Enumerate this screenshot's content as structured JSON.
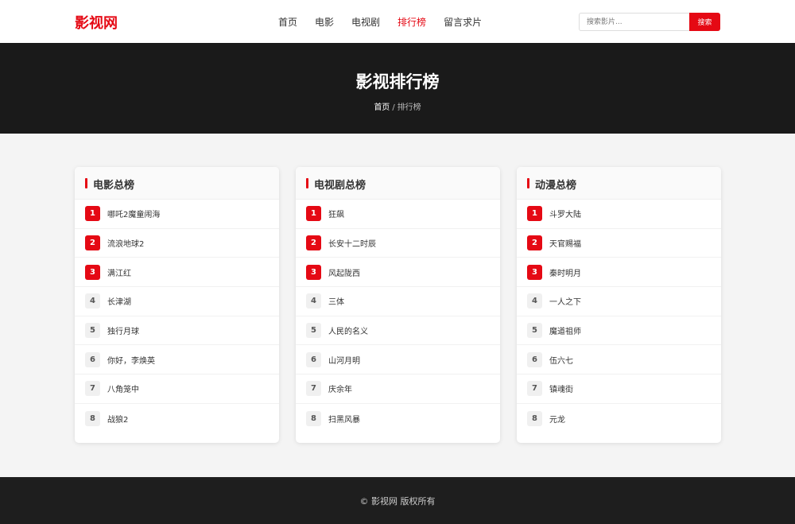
{
  "header": {
    "logo": "影视网",
    "nav": [
      {
        "label": "首页",
        "active": false
      },
      {
        "label": "电影",
        "active": false
      },
      {
        "label": "电视剧",
        "active": false
      },
      {
        "label": "排行榜",
        "active": true
      },
      {
        "label": "留言求片",
        "active": false
      }
    ],
    "search": {
      "placeholder": "搜索影片...",
      "value": "",
      "button_label": "搜索"
    }
  },
  "hero": {
    "title": "影视排行榜",
    "breadcrumb": {
      "home": "首页",
      "separator": "/",
      "current": "排行榜"
    }
  },
  "boards": [
    {
      "title": "电影总榜",
      "items": [
        {
          "rank": "1",
          "name": "哪吒2魔童闹海"
        },
        {
          "rank": "2",
          "name": "流浪地球2"
        },
        {
          "rank": "3",
          "name": "满江红"
        },
        {
          "rank": "4",
          "name": "长津湖"
        },
        {
          "rank": "5",
          "name": "独行月球"
        },
        {
          "rank": "6",
          "name": "你好，李焕英"
        },
        {
          "rank": "7",
          "name": "八角笼中"
        },
        {
          "rank": "8",
          "name": "战狼2"
        }
      ]
    },
    {
      "title": "电视剧总榜",
      "items": [
        {
          "rank": "1",
          "name": "狂飙"
        },
        {
          "rank": "2",
          "name": "长安十二时辰"
        },
        {
          "rank": "3",
          "name": "风起陇西"
        },
        {
          "rank": "4",
          "name": "三体"
        },
        {
          "rank": "5",
          "name": "人民的名义"
        },
        {
          "rank": "6",
          "name": "山河月明"
        },
        {
          "rank": "7",
          "name": "庆余年"
        },
        {
          "rank": "8",
          "name": "扫黑风暴"
        }
      ]
    },
    {
      "title": "动漫总榜",
      "items": [
        {
          "rank": "1",
          "name": "斗罗大陆"
        },
        {
          "rank": "2",
          "name": "天官赐福"
        },
        {
          "rank": "3",
          "name": "秦时明月"
        },
        {
          "rank": "4",
          "name": "一人之下"
        },
        {
          "rank": "5",
          "name": "魔道祖师"
        },
        {
          "rank": "6",
          "name": "伍六七"
        },
        {
          "rank": "7",
          "name": "镇魂街"
        },
        {
          "rank": "8",
          "name": "元龙"
        }
      ]
    }
  ],
  "footer": {
    "copyright": "© 影视网 版权所有"
  },
  "colors": {
    "accent": "#e50914",
    "dark": "#1a1a1a",
    "background": "#f4f4f4"
  }
}
